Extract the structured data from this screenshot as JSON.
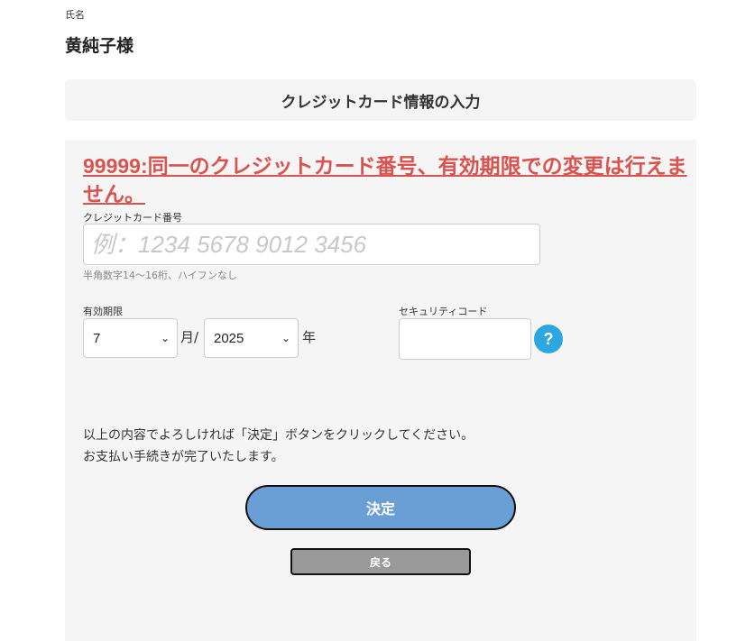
{
  "customer": {
    "label": "氏名",
    "name": "黄純子様"
  },
  "section": {
    "title": "クレジットカード情報の入力"
  },
  "error": {
    "message": "99999:同一のクレジットカード番号、有効期限での変更は行えません。"
  },
  "card_number": {
    "label": "クレジットカード番号",
    "placeholder": "例：1234 5678 9012 3456",
    "value": "",
    "hint": "半角数字14〜16桁、ハイフンなし"
  },
  "expiry": {
    "label": "有効期限",
    "month_value": "7",
    "month_unit": "月/",
    "year_value": "2025",
    "year_unit": "年"
  },
  "security_code": {
    "label": "セキュリティコード",
    "help_symbol": "?"
  },
  "instructions": {
    "line1": "以上の内容でよろしければ「決定」ボタンをクリックしてください。",
    "line2": "お支払い手続きが完了いたします。"
  },
  "buttons": {
    "submit_label": "決定",
    "back_label": "戻る"
  },
  "colors": {
    "error": "#d9534f",
    "submit_bg": "#6a9fd6",
    "back_bg": "#999999",
    "help_icon": "#2ea7e0",
    "panel_bg": "#f5f5f5"
  }
}
